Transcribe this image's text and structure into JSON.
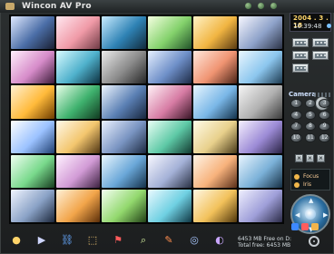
{
  "window": {
    "title": "Wincon AV Pro"
  },
  "clock": {
    "date": "2004 . 3 . 18",
    "time": "10:39:48"
  },
  "camera_panel": {
    "label": "Camera",
    "buttons": [
      "1",
      "2",
      "3",
      "4",
      "5",
      "6",
      "7",
      "8",
      "9",
      "10",
      "11",
      "12"
    ]
  },
  "ptz": {
    "rows": [
      "Focus",
      "Iris"
    ]
  },
  "storage": {
    "free_line": "6453 MB Free on D:",
    "total_line": "Total free: 6453 MB"
  },
  "toolbar": {
    "icons": [
      {
        "name": "record-icon",
        "glyph": "●"
      },
      {
        "name": "playback-icon",
        "glyph": "▶"
      },
      {
        "name": "network-icon",
        "glyph": "⛓"
      },
      {
        "name": "backup-icon",
        "glyph": "⬚"
      },
      {
        "name": "alarm-icon",
        "glyph": "⚑"
      },
      {
        "name": "search-icon",
        "glyph": "⌕"
      },
      {
        "name": "setup-icon",
        "glyph": "✎"
      },
      {
        "name": "disk-icon",
        "glyph": "◎"
      },
      {
        "name": "exit-icon",
        "glyph": "◐"
      }
    ]
  },
  "colors": {
    "accent_amber": "#f0b64a",
    "clock_date": "#ffd66b",
    "joystick_blue": "#2b6ea1"
  }
}
